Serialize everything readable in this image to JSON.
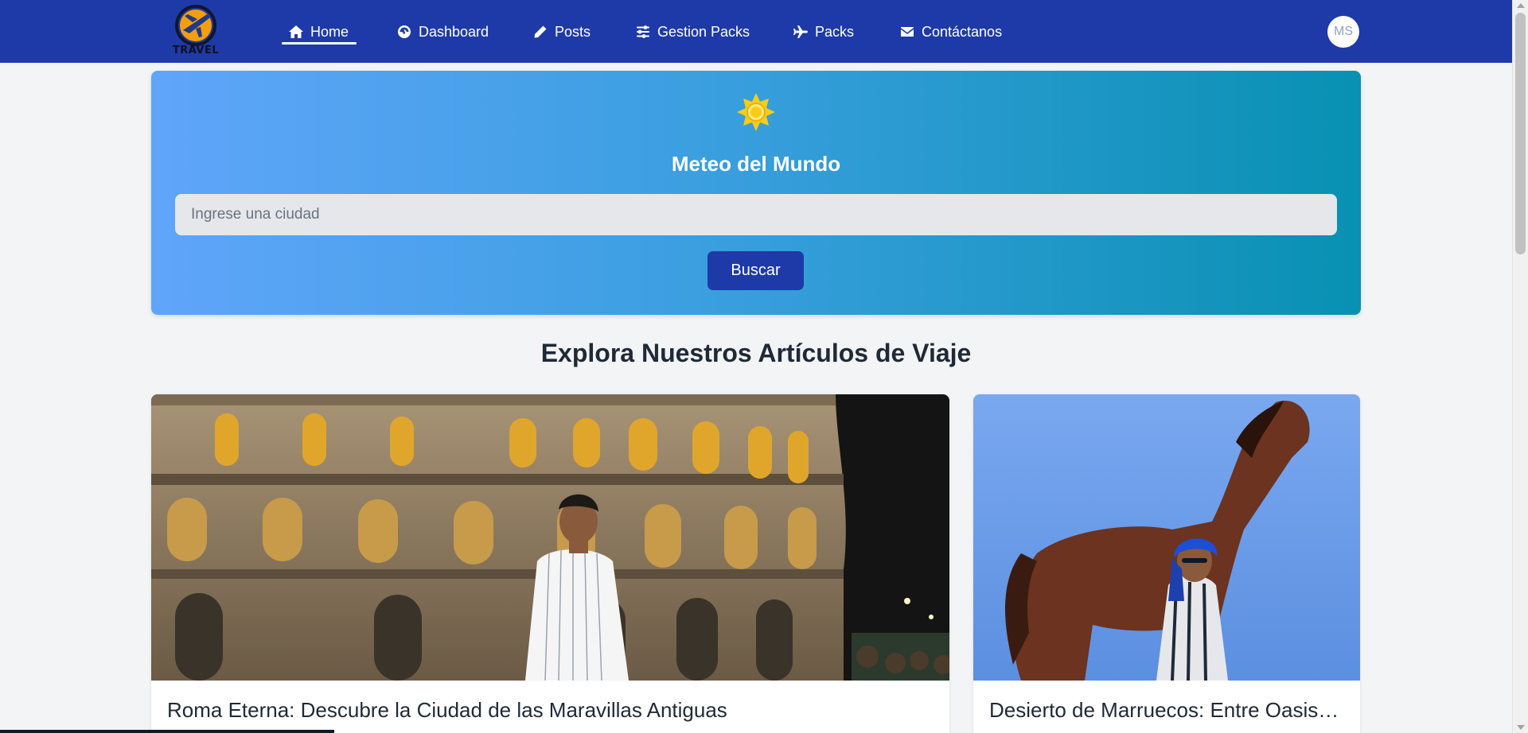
{
  "navbar": {
    "logo_text": "TRAVEL",
    "items": [
      {
        "label": "Home",
        "icon": "home-icon",
        "active": true
      },
      {
        "label": "Dashboard",
        "icon": "gauge-icon",
        "active": false
      },
      {
        "label": "Posts",
        "icon": "pencil-icon",
        "active": false
      },
      {
        "label": "Gestion Packs",
        "icon": "sliders-icon",
        "active": false
      },
      {
        "label": "Packs",
        "icon": "plane-icon",
        "active": false
      },
      {
        "label": "Contáctanos",
        "icon": "envelope-icon",
        "active": false
      }
    ],
    "avatar_initials": "MS"
  },
  "weather": {
    "icon": "sun-icon",
    "title": "Meteo del Mundo",
    "input_placeholder": "Ingrese una ciudad",
    "input_value": "",
    "button_label": "Buscar"
  },
  "articles": {
    "section_title": "Explora Nuestros Artículos de Viaje",
    "items": [
      {
        "title": "Roma Eterna: Descubre la Ciudad de las Maravillas Antiguas",
        "meta": "",
        "image": "colosseum-night-photo"
      },
      {
        "title": "Desierto de Marruecos: Entre Oasis y Dunas",
        "meta": "",
        "image": "horse-desert-photo"
      }
    ]
  },
  "colors": {
    "navbar": "#1e3aa8",
    "weather_gradient_start": "#60a5fa",
    "weather_gradient_end": "#0891b2",
    "button": "#1e3aa8",
    "page_bg": "#f3f4f6"
  }
}
